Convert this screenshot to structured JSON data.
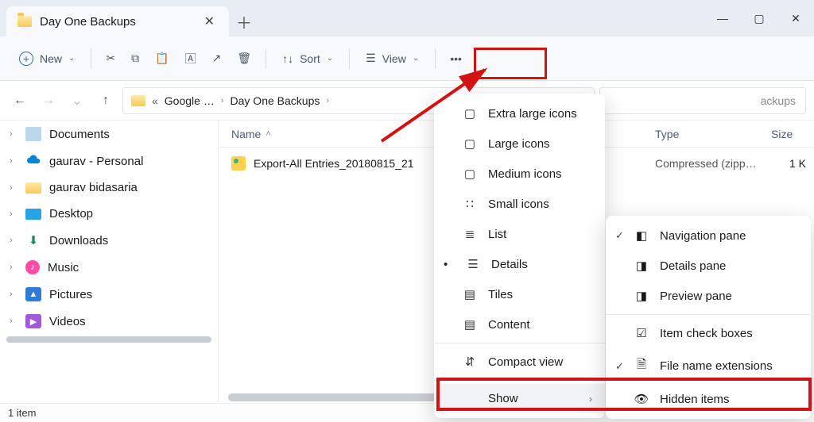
{
  "window": {
    "tab_title": "Day One Backups"
  },
  "toolbar": {
    "new_label": "New",
    "sort_label": "Sort",
    "view_label": "View"
  },
  "breadcrumb": {
    "ellipsis": "«",
    "part1": "Google …",
    "part2": "Day One Backups"
  },
  "search": {
    "placeholder_suffix": "ackups"
  },
  "sidebar": {
    "items": [
      {
        "label": "Documents",
        "icon": "documents"
      },
      {
        "label": "gaurav - Personal",
        "icon": "onedrive"
      },
      {
        "label": "gaurav bidasaria",
        "icon": "folder"
      },
      {
        "label": "Desktop",
        "icon": "desktop"
      },
      {
        "label": "Downloads",
        "icon": "downloads"
      },
      {
        "label": "Music",
        "icon": "music"
      },
      {
        "label": "Pictures",
        "icon": "pictures"
      },
      {
        "label": "Videos",
        "icon": "videos"
      }
    ]
  },
  "columns": {
    "name": "Name",
    "type": "Type",
    "size": "Size"
  },
  "files": [
    {
      "name": "Export-All Entries_20180815_21",
      "type": "Compressed (zipp…",
      "size": "1 K"
    }
  ],
  "view_menu": {
    "items": [
      {
        "label": "Extra large icons"
      },
      {
        "label": "Large icons"
      },
      {
        "label": "Medium icons"
      },
      {
        "label": "Small icons"
      },
      {
        "label": "List"
      },
      {
        "label": "Details",
        "selected": true
      },
      {
        "label": "Tiles"
      },
      {
        "label": "Content"
      }
    ],
    "compact": "Compact view",
    "show": "Show"
  },
  "show_menu": {
    "items": [
      {
        "label": "Navigation pane",
        "checked": true
      },
      {
        "label": "Details pane"
      },
      {
        "label": "Preview pane"
      },
      {
        "label": "Item check boxes"
      },
      {
        "label": "File name extensions",
        "checked": true
      },
      {
        "label": "Hidden items"
      }
    ]
  },
  "status": {
    "text": "1 item"
  }
}
